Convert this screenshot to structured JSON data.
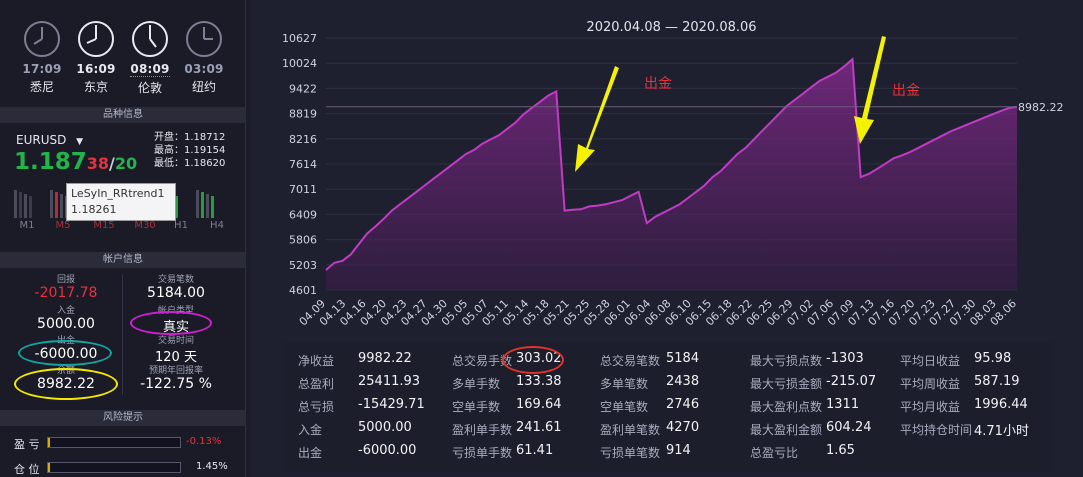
{
  "clocks": [
    {
      "time": "17:09",
      "city": "悉尼"
    },
    {
      "time": "16:09",
      "city": "东京"
    },
    {
      "time": "08:09",
      "city": "伦敦"
    },
    {
      "time": "03:09",
      "city": "纽约"
    }
  ],
  "product": {
    "section_title": "品种信息",
    "symbol": "EURUSD",
    "price_big": "1.187",
    "price_red": "38",
    "price_sep": "/",
    "price_green": "20",
    "open": "开盘：1.18712",
    "high": "最高：1.19154",
    "low": "最低：1.18620",
    "timeframes": [
      "M1",
      "M5",
      "M15",
      "M30",
      "H1",
      "H4"
    ],
    "tooltip_name": "LeSyIn_RRtrend1",
    "tooltip_price": "1.18261"
  },
  "account": {
    "section_title": "帐户信息",
    "drawdown_label": "回报",
    "drawdown_value": "-2017.78",
    "trades_label": "交易笔数",
    "trades_value": "5184.00",
    "deposit_label": "入金",
    "deposit_value": "5000.00",
    "type_label": "帐户类型",
    "type_value": "真实",
    "withdraw_label": "出金",
    "withdraw_value": "-6000.00",
    "time_label": "交易时间",
    "time_value": "120 天",
    "equity_label": "余额",
    "equity_value": "8982.22",
    "annual_label": "预期年回报率",
    "annual_value": "-122.75 %"
  },
  "risk": {
    "section_title": "风险提示",
    "pl_label": "盈 亏",
    "pl_value": "-0.13%",
    "pos_label": "仓 位",
    "pos_value": "1.45%"
  },
  "chart_data": {
    "type": "area",
    "title": "2020.04.08 — 2020.08.06",
    "ylim": [
      4601,
      10627
    ],
    "yticks": [
      4601,
      5203,
      5806,
      6409,
      7011,
      7614,
      8216,
      8819,
      9422,
      10024,
      10627
    ],
    "xticks": [
      "04.09",
      "04.13",
      "04.16",
      "04.20",
      "04.23",
      "04.27",
      "04.30",
      "05.05",
      "05.07",
      "05.11",
      "05.14",
      "05.18",
      "05.21",
      "05.25",
      "05.28",
      "06.01",
      "06.04",
      "06.08",
      "06.10",
      "06.15",
      "06.18",
      "06.22",
      "06.25",
      "06.29",
      "07.02",
      "07.06",
      "07.09",
      "07.13",
      "07.16",
      "07.20",
      "07.23",
      "07.27",
      "07.30",
      "08.03",
      "08.06"
    ],
    "last_value_label": "8982.22",
    "annotation_text": "出金",
    "line_color": "#c23bc4",
    "values": [
      5080,
      5250,
      5300,
      5450,
      5700,
      5950,
      6120,
      6300,
      6500,
      6650,
      6800,
      6950,
      7100,
      7250,
      7400,
      7550,
      7700,
      7850,
      7950,
      8100,
      8200,
      8300,
      8450,
      8600,
      8800,
      8950,
      9100,
      9250,
      9350,
      6500,
      6520,
      6530,
      6600,
      6620,
      6650,
      6700,
      6750,
      6850,
      6950,
      6200,
      6350,
      6450,
      6550,
      6650,
      6800,
      6950,
      7100,
      7300,
      7450,
      7650,
      7850,
      8000,
      8200,
      8400,
      8600,
      8800,
      9000,
      9150,
      9300,
      9450,
      9600,
      9700,
      9800,
      9950,
      10120,
      7300,
      7380,
      7500,
      7620,
      7750,
      7820,
      7900,
      8000,
      8100,
      8200,
      8300,
      8400,
      8480,
      8560,
      8640,
      8720,
      8800,
      8880,
      8950,
      8982.22
    ],
    "series": [
      {
        "values_ref": "values"
      }
    ]
  },
  "stats": {
    "col1": [
      [
        "净收益",
        "9982.22"
      ],
      [
        "总盈利",
        "25411.93"
      ],
      [
        "总亏损",
        "-15429.71"
      ],
      [
        "入金",
        "5000.00"
      ],
      [
        "出金",
        "-6000.00"
      ]
    ],
    "col2": [
      [
        "总交易手数",
        "303.02"
      ],
      [
        "多单手数",
        "133.38"
      ],
      [
        "空单手数",
        "169.64"
      ],
      [
        "盈利单手数",
        "241.61"
      ],
      [
        "亏损单手数",
        "61.41"
      ]
    ],
    "col3": [
      [
        "总交易笔数",
        "5184"
      ],
      [
        "多单笔数",
        "2438"
      ],
      [
        "空单笔数",
        "2746"
      ],
      [
        "盈利单笔数",
        "4270"
      ],
      [
        "亏损单笔数",
        "914"
      ]
    ],
    "col4": [
      [
        "最大亏损点数",
        "-1303"
      ],
      [
        "最大亏损金额",
        "-215.07"
      ],
      [
        "最大盈利点数",
        "1311"
      ],
      [
        "最大盈利金额",
        "604.24"
      ],
      [
        "总盈亏比",
        "1.65"
      ]
    ],
    "col5": [
      [
        "平均日收益",
        "95.98"
      ],
      [
        "平均周收益",
        "587.19"
      ],
      [
        "平均月收益",
        "1996.44"
      ],
      [
        "平均持仓时间",
        "4.71小时"
      ]
    ]
  }
}
